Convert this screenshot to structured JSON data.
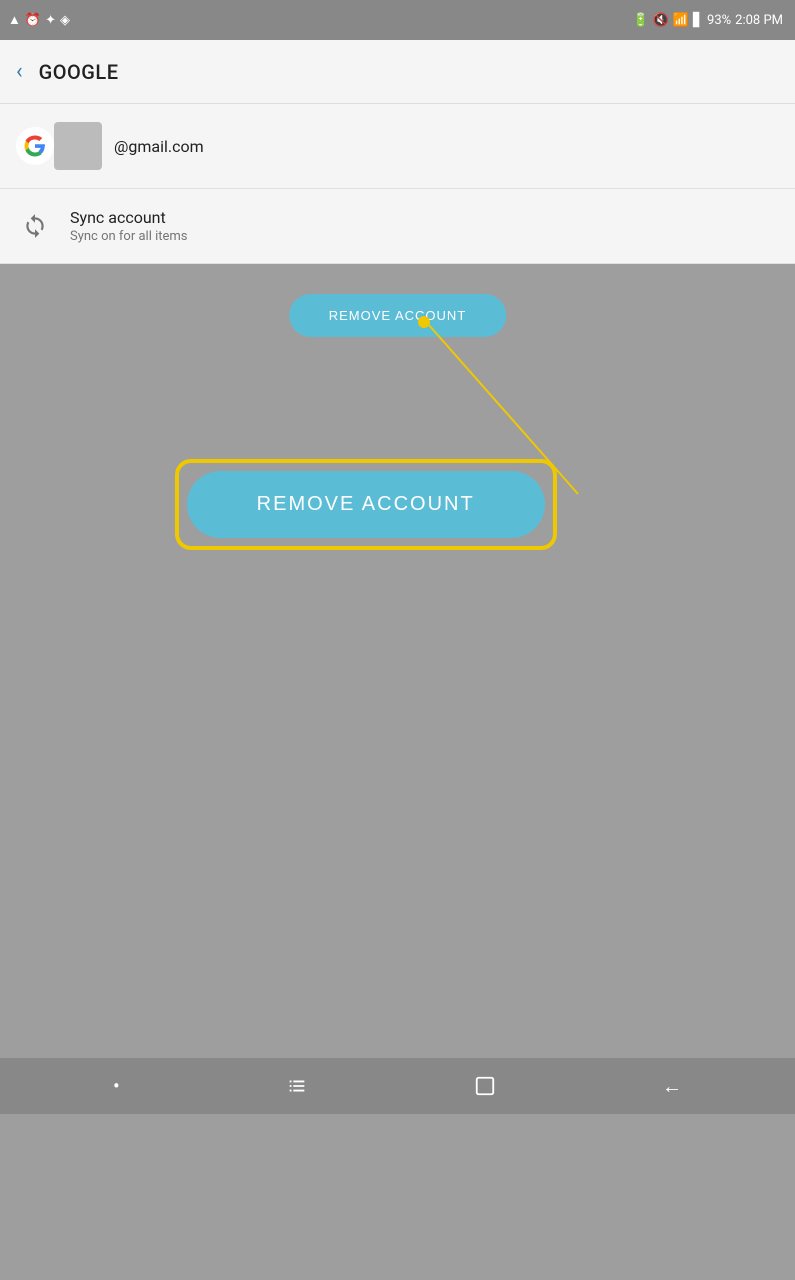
{
  "statusBar": {
    "battery": "93%",
    "time": "2:08 PM",
    "batteryIcon": "battery-icon",
    "wifiIcon": "wifi-icon",
    "muteIcon": "mute-icon"
  },
  "header": {
    "backLabel": "‹",
    "title": "GOOGLE"
  },
  "account": {
    "email": "@gmail.com",
    "avatarAlt": "profile-avatar"
  },
  "sync": {
    "title": "Sync account",
    "subtitle": "Sync on for all items"
  },
  "removeAccountBtn": {
    "label": "REMOVE ACCOUNT",
    "labelLarge": "REMOVE ACCOUNT"
  },
  "navBar": {
    "menuIcon": "⠂",
    "recentIcon": "⬜",
    "homeIcon": "⌂",
    "backIcon": "←"
  },
  "annotation": {
    "color": "#f0c800"
  }
}
